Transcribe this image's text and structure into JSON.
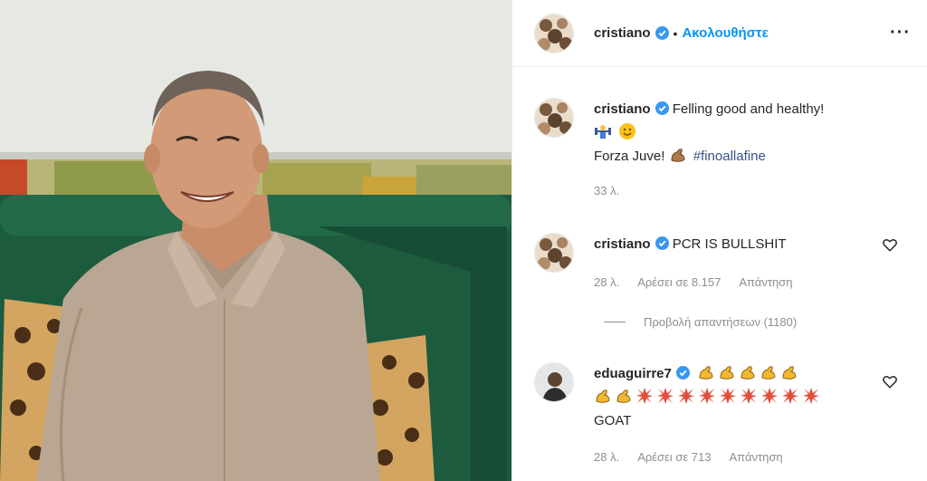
{
  "post": {
    "author": "cristiano",
    "follow_label": "Ακολουθήστε",
    "separator": "•",
    "more_label": "···"
  },
  "caption": {
    "author": "cristiano",
    "line1": "Felling good and healthy!",
    "line2_text": "Forza Juve!",
    "hashtag": "#finoallafine",
    "time": "33 λ."
  },
  "comments": [
    {
      "author": "cristiano",
      "text": "PCR IS BULLSHIT",
      "time": "28 λ.",
      "likes_label": "Αρέσει σε 8.157",
      "reply_label": "Απάντηση"
    },
    {
      "author": "eduaguirre7",
      "text_line3": "GOAT",
      "time": "28 λ.",
      "likes_label": "Αρέσει σε 713",
      "reply_label": "Απάντηση"
    }
  ],
  "view_replies_label": "Προβολή απαντήσεων (1180)",
  "colors": {
    "accent": "#0095f6",
    "verified": "#3897f0",
    "muted": "#8e8e8e",
    "sofa": "#1d5b3f",
    "shirt": "#b9a693"
  },
  "icons": {
    "verified": "verified-badge-icon",
    "heart": "heart-outline-icon",
    "muscle": "flexed-biceps-emoji",
    "anger": "anger-symbol-emoji"
  }
}
